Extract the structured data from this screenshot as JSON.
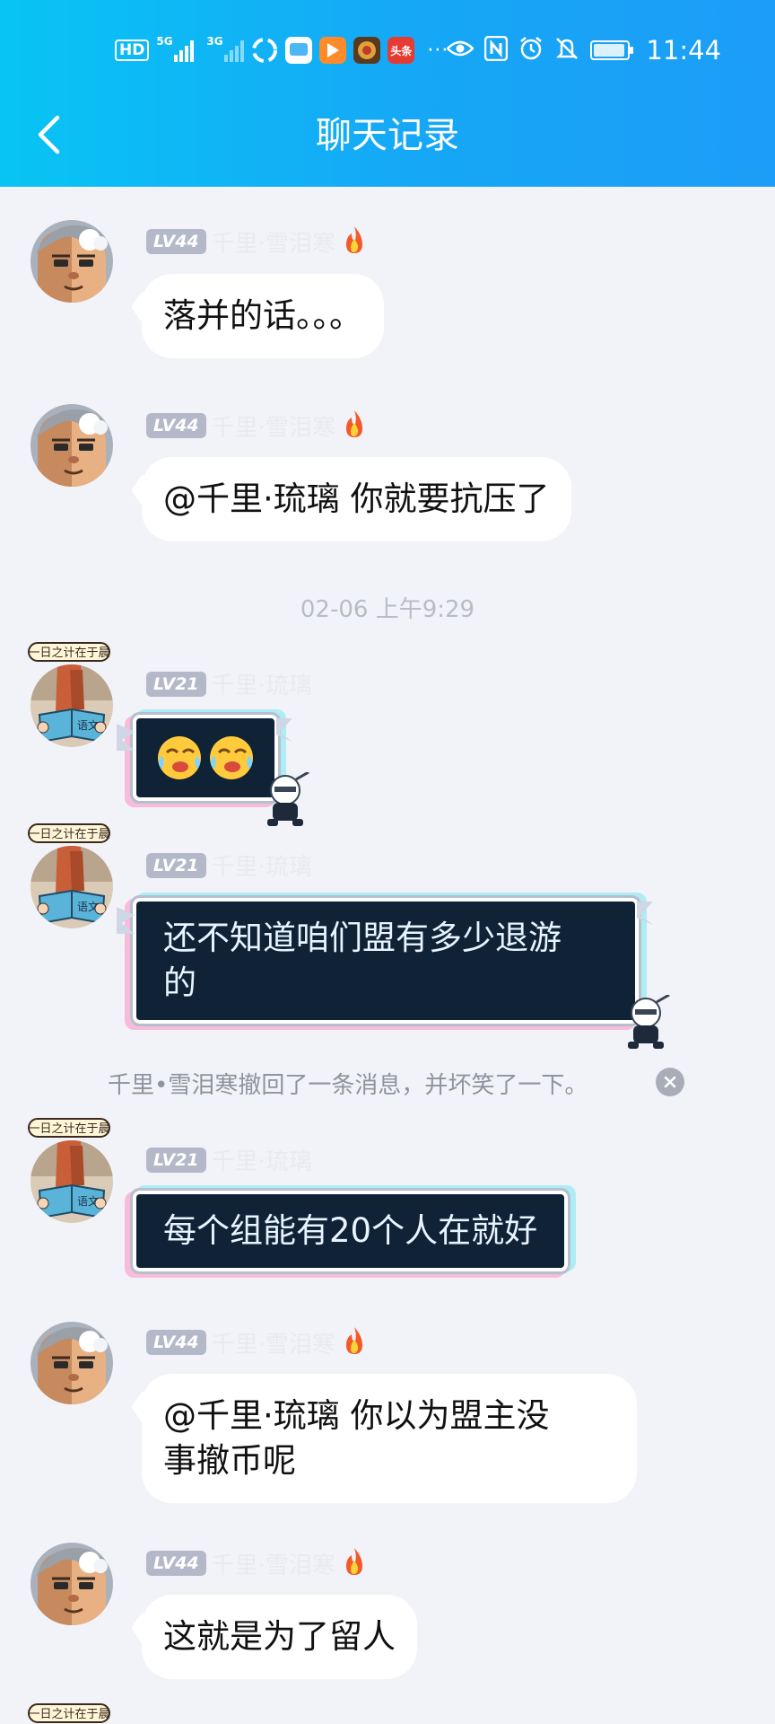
{
  "status_bar": {
    "hd_label": "HD",
    "sig1_label": "5G",
    "sig2_label": "3G",
    "app_badge_label": "头条",
    "more_dots": "···",
    "time": "11:44",
    "icons": [
      "eye-icon",
      "nfc-icon",
      "alarm-icon",
      "mute-icon",
      "battery-icon"
    ]
  },
  "header": {
    "title": "聊天记录",
    "back_icon": "chevron-left-icon"
  },
  "messages": [
    {
      "level": "LV44",
      "sender": "千里·雪泪寒",
      "flame": true,
      "text": "落并的话。。。"
    },
    {
      "level": "LV44",
      "sender": "千里·雪泪寒",
      "flame": true,
      "text": "@千里·琉璃 你就要抗压了"
    },
    {
      "level": "LV21",
      "sender": "千里·琉璃",
      "flame": false,
      "emoji": [
        "crying-face",
        "crying-face"
      ]
    },
    {
      "level": "LV21",
      "sender": "千里·琉璃",
      "flame": false,
      "text_line1": "还不知道咱们盟有多少退游",
      "text_line2": "的"
    },
    {
      "level": "LV21",
      "sender": "千里·琉璃",
      "flame": false,
      "text": "每个组能有20个人在就好"
    },
    {
      "level": "LV44",
      "sender": "千里·雪泪寒",
      "flame": true,
      "text_line1": "@千里·琉璃 你以为盟主没",
      "text_line2": "事撤币呢"
    },
    {
      "level": "LV44",
      "sender": "千里·雪泪寒",
      "flame": true,
      "text": "这就是为了留人"
    }
  ],
  "timestamp": "02-06 上午9:29",
  "recall_notice": "千里•雪泪寒撤回了一条消息，并坏笑了一下。",
  "avatar_tag_text": "一日之计在于晨",
  "book_label": "语文",
  "colors": {
    "header_start": "#08c4f4",
    "header_end": "#1c9df7",
    "background": "#f2f3f8",
    "bubble": "#ffffff",
    "fancy_bubble": "#0f2236",
    "level_badge": "#b3b9c8"
  }
}
